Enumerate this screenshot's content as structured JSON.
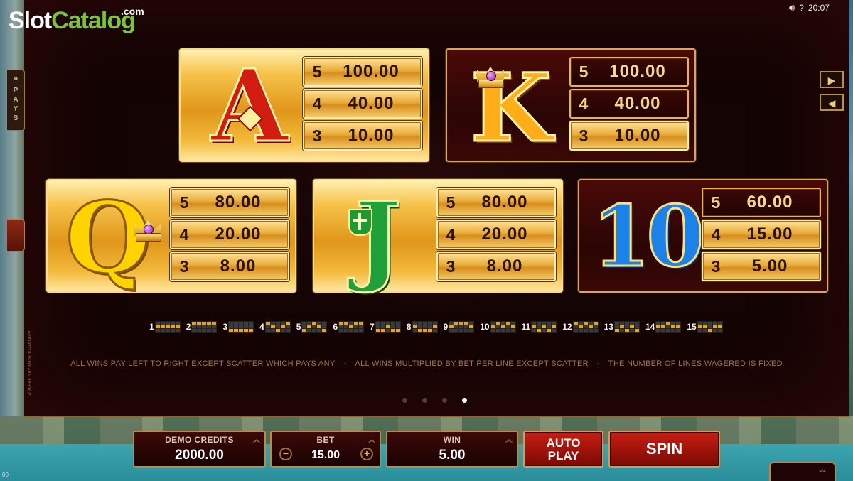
{
  "branding": {
    "logo_slot": "Slot",
    "logo_catalog": "Catalog",
    "logo_com": ".com"
  },
  "status": {
    "sound_icon": "speaker-icon",
    "help": "?",
    "time": "20:07"
  },
  "side_tab": {
    "label": "PAYS",
    "icon": "double-chevron-right-icon"
  },
  "powered_by": "POWERED BY MICROGAMING™",
  "paytable": [
    {
      "symbol": "A",
      "style": "gold",
      "rows": [
        {
          "count": "5",
          "value": "100.00"
        },
        {
          "count": "4",
          "value": "40.00"
        },
        {
          "count": "3",
          "value": "10.00"
        }
      ]
    },
    {
      "symbol": "K",
      "style": "red",
      "rows": [
        {
          "count": "5",
          "value": "100.00"
        },
        {
          "count": "4",
          "value": "40.00"
        },
        {
          "count": "3",
          "value": "10.00"
        }
      ]
    },
    {
      "symbol": "Q",
      "style": "gold",
      "rows": [
        {
          "count": "5",
          "value": "80.00"
        },
        {
          "count": "4",
          "value": "20.00"
        },
        {
          "count": "3",
          "value": "8.00"
        }
      ]
    },
    {
      "symbol": "J",
      "style": "gold",
      "rows": [
        {
          "count": "5",
          "value": "80.00"
        },
        {
          "count": "4",
          "value": "20.00"
        },
        {
          "count": "3",
          "value": "8.00"
        }
      ]
    },
    {
      "symbol": "10",
      "style": "red",
      "rows": [
        {
          "count": "5",
          "value": "60.00"
        },
        {
          "count": "4",
          "value": "15.00"
        },
        {
          "count": "3",
          "value": "5.00"
        }
      ]
    }
  ],
  "paylines": [
    "1",
    "2",
    "3",
    "4",
    "5",
    "6",
    "7",
    "8",
    "9",
    "10",
    "11",
    "12",
    "13",
    "14",
    "15"
  ],
  "rules": {
    "r1": "ALL WINS PAY LEFT TO RIGHT EXCEPT SCATTER WHICH PAYS ANY",
    "r2": "ALL WINS MULTIPLIED BY BET PER LINE EXCEPT SCATTER",
    "r3": "THE NUMBER OF LINES WAGERED IS FIXED",
    "separator": "-"
  },
  "pagination": {
    "pages": 4,
    "current": 4
  },
  "bottom_bar": {
    "credits_label": "DEMO CREDITS",
    "credits_value": "2000.00",
    "bet_label": "BET",
    "bet_value": "15.00",
    "bet_minus": "−",
    "bet_plus": "+",
    "win_label": "WIN",
    "win_value": "5.00",
    "autoplay_line1": "AUTO",
    "autoplay_line2": "PLAY",
    "spin_label": "SPIN",
    "expand_icon": "double-chevron-up-icon"
  },
  "footer_tiny": "00"
}
